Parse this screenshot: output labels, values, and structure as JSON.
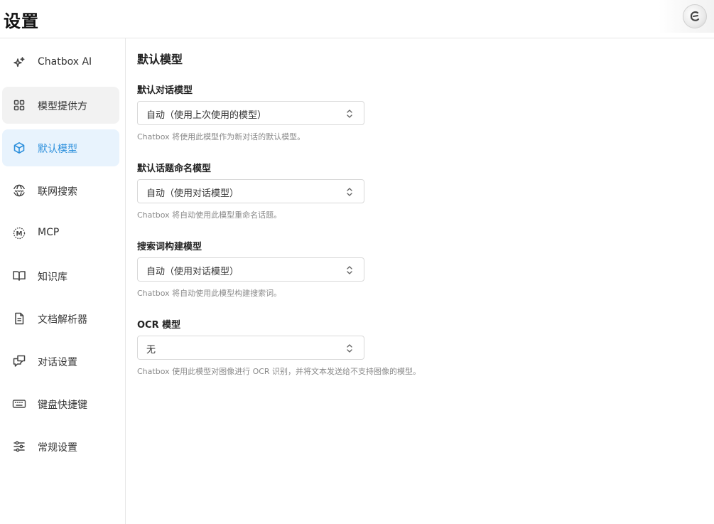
{
  "header": {
    "title": "设置",
    "logo_icon": "chatbox-logo-icon"
  },
  "sidebar": {
    "items": [
      {
        "label": "Chatbox AI",
        "icon": "sparkles-icon"
      },
      {
        "label": "模型提供方",
        "icon": "grid-icon",
        "state": "hover"
      },
      {
        "label": "默认模型",
        "icon": "cube-icon",
        "state": "active"
      },
      {
        "label": "联网搜索",
        "icon": "www-globe-icon"
      },
      {
        "label": "MCP",
        "icon": "mcp-icon"
      },
      {
        "label": "知识库",
        "icon": "book-icon"
      },
      {
        "label": "文档解析器",
        "icon": "document-icon"
      },
      {
        "label": "对话设置",
        "icon": "chat-bubbles-icon"
      },
      {
        "label": "键盘快捷键",
        "icon": "keyboard-icon"
      },
      {
        "label": "常规设置",
        "icon": "sliders-icon"
      }
    ],
    "active_color": "#2b8fdc"
  },
  "main": {
    "title": "默认模型",
    "fields": [
      {
        "label": "默认对话模型",
        "value": "自动（使用上次使用的模型）",
        "hint": "Chatbox 将使用此模型作为新对话的默认模型。"
      },
      {
        "label": "默认话题命名模型",
        "value": "自动（使用对话模型）",
        "hint": "Chatbox 将自动使用此模型重命名话题。"
      },
      {
        "label": "搜索词构建模型",
        "value": "自动（使用对话模型）",
        "hint": "Chatbox 将自动使用此模型构建搜索词。"
      },
      {
        "label": "OCR 模型",
        "value": "无",
        "hint": "Chatbox 使用此模型对图像进行 OCR 识别，并将文本发送给不支持图像的模型。"
      }
    ]
  }
}
